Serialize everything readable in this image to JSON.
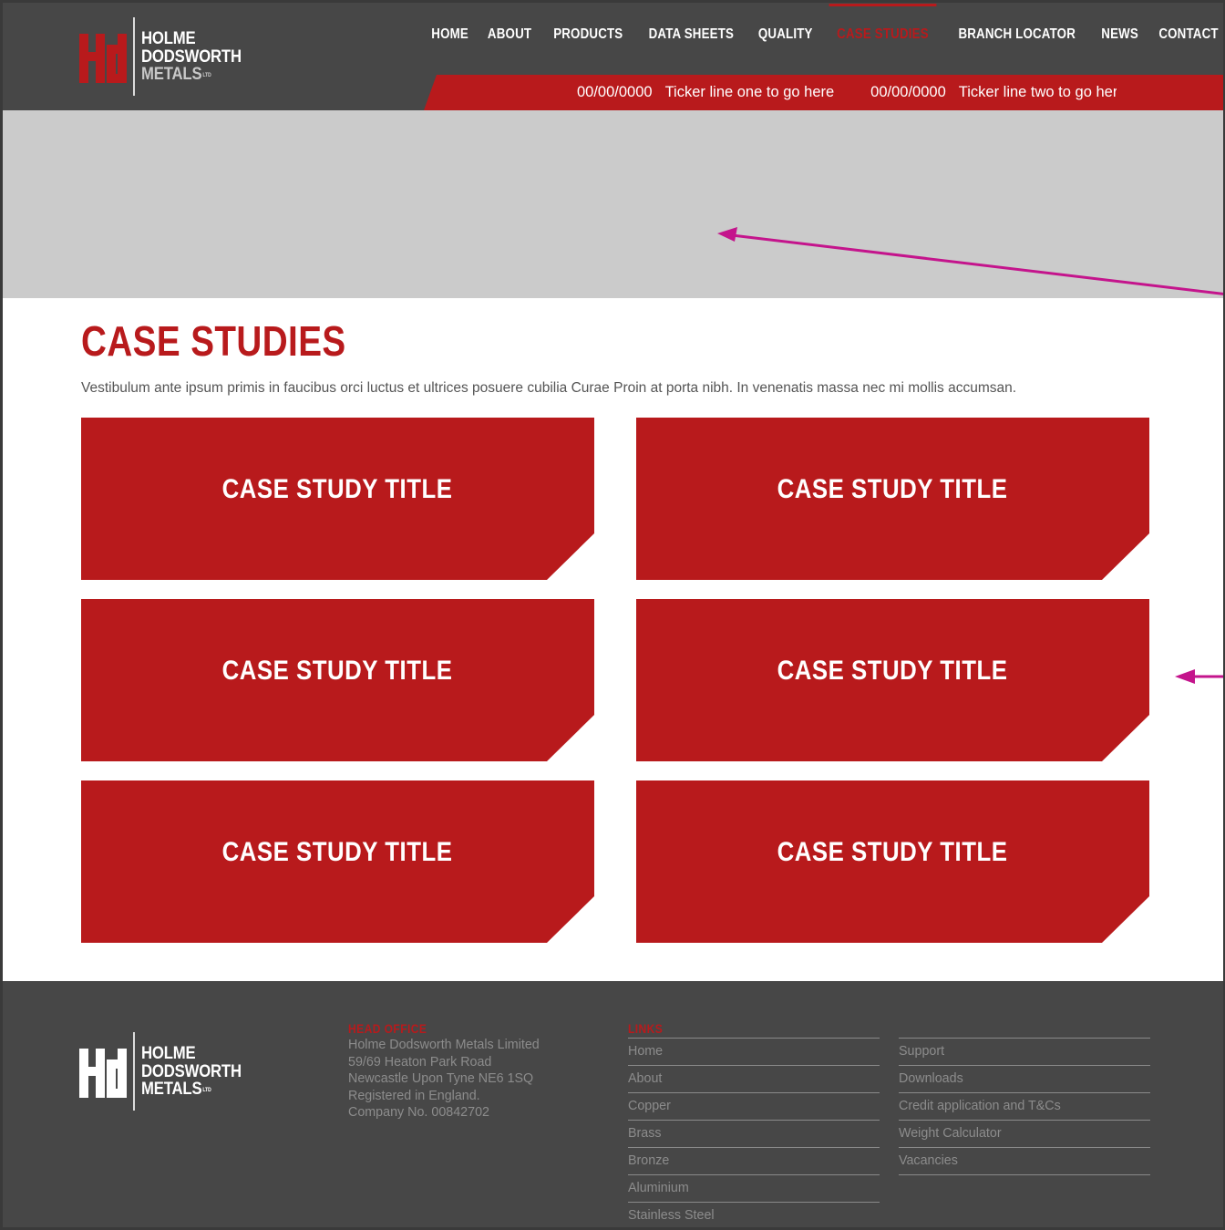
{
  "brand": {
    "line1": "HOLME",
    "line2": "DODSWORTH",
    "line3": "METALS",
    "ltd": "LTD",
    "colors": {
      "red": "#b81a1c",
      "dark": "#474747",
      "hero": "#cbcbcb"
    }
  },
  "nav": {
    "items": [
      "HOME",
      "ABOUT",
      "PRODUCTS",
      "DATA SHEETS",
      "QUALITY",
      "CASE STUDIES",
      "BRANCH LOCATOR",
      "NEWS",
      "CONTACT"
    ],
    "active": "CASE STUDIES"
  },
  "ticker": [
    {
      "date": "00/00/0000",
      "text": "Ticker line one to go here"
    },
    {
      "date": "00/00/0000",
      "text": "Ticker line two to go her"
    }
  ],
  "main": {
    "title": "CASE STUDIES",
    "intro": "Vestibulum ante ipsum primis in faucibus orci luctus et ultrices posuere cubilia Curae Proin at porta nibh. In venenatis massa nec mi mollis accumsan.",
    "cards": [
      "CASE STUDY TITLE",
      "CASE STUDY TITLE",
      "CASE STUDY TITLE",
      "CASE STUDY TITLE",
      "CASE STUDY TITLE",
      "CASE STUDY TITLE"
    ]
  },
  "footer": {
    "head_office_title": "HEAD OFFICE",
    "address": [
      "Holme Dodsworth Metals Limited",
      "59/69 Heaton Park Road",
      "Newcastle Upon Tyne NE6 1SQ",
      "Registered in England.",
      "Company No. 00842702"
    ],
    "links_title": "LINKS",
    "links_col1": [
      "Home",
      "About",
      "Copper",
      "Brass",
      "Bronze",
      "Aluminium",
      "Stainless Steel"
    ],
    "links_col2": [
      "Support",
      "Downloads",
      "Credit application and T&Cs",
      "Weight Calculator",
      "Vacancies"
    ]
  }
}
